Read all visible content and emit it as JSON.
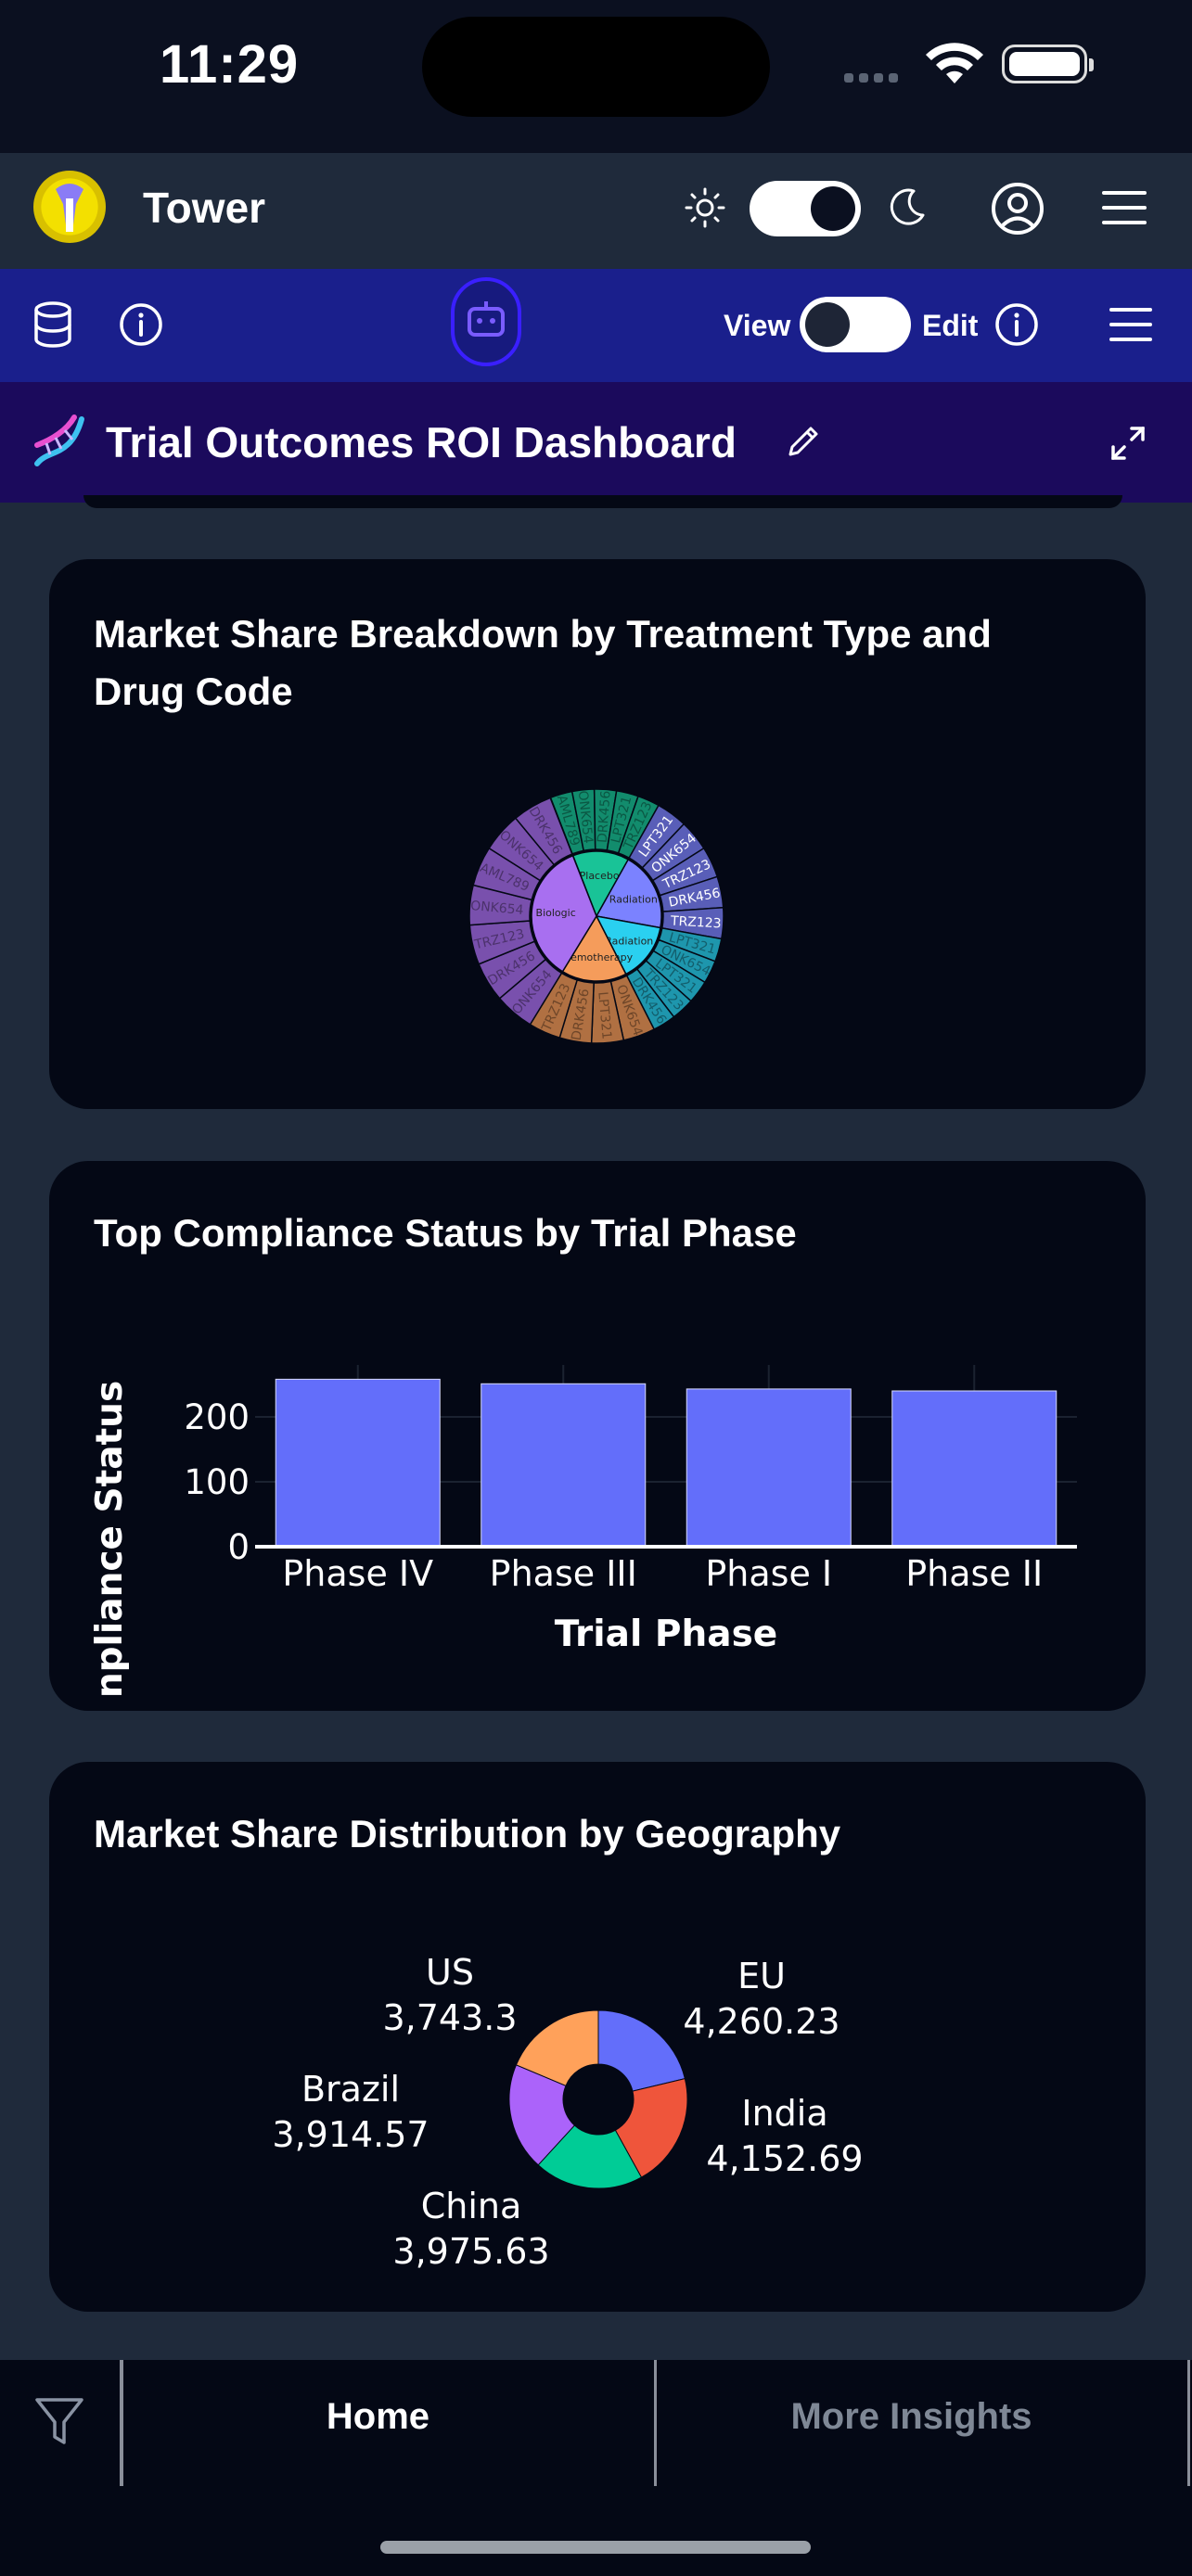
{
  "status_bar": {
    "time": "11:29"
  },
  "header": {
    "app_name": "Tower"
  },
  "toolbar": {
    "view_label": "View",
    "edit_label": "Edit"
  },
  "dashboard": {
    "title": "Trial Outcomes ROI Dashboard"
  },
  "charts": {
    "sunburst_title": "Market Share Breakdown by Treatment Type and Drug Code",
    "bar_title": "Top Compliance Status by Trial Phase",
    "donut_title": "Market Share Distribution by Geography"
  },
  "chart_data": [
    {
      "type": "sunburst",
      "title": "Market Share Breakdown by Treatment Type and Drug Code",
      "inner": [
        {
          "label": "Placebo",
          "color": "#19c397"
        },
        {
          "label": "Radiation",
          "color": "#7b82ff"
        },
        {
          "label": "Radiation",
          "color": "#2ad0f0"
        },
        {
          "label": "Chemotherapy",
          "color": "#f59c5b"
        },
        {
          "label": "Biologic",
          "color": "#a86ff0"
        }
      ],
      "outer_labels_visible": [
        "AML789",
        "ONK654",
        "DRK456",
        "LPT321",
        "TRZ123",
        "LPT321",
        "ONK654",
        "TRZ123",
        "DRK456",
        "TRZ123",
        "LPT321",
        "ONK654",
        "LPT321",
        "TRZ123",
        "DRK456",
        "ONK654",
        "LPT321",
        "DRK456",
        "TRZ123",
        "ONK654",
        "DRK456",
        "TRZ123",
        "ONK654"
      ]
    },
    {
      "type": "bar",
      "title": "Top Compliance Status by Trial Phase",
      "xlabel": "Trial Phase",
      "ylabel": "Compliance Status",
      "ylabel_visible": "npliance Status",
      "categories": [
        "Phase IV",
        "Phase III",
        "Phase I",
        "Phase II"
      ],
      "values": [
        258,
        251,
        243,
        240
      ],
      "yticks": [
        "0",
        "100",
        "200"
      ],
      "ylim": [
        0,
        280
      ],
      "bar_color": "#636efa"
    },
    {
      "type": "pie",
      "hole": true,
      "title": "Market Share Distribution by Geography",
      "labels": [
        "EU",
        "India",
        "China",
        "Brazil",
        "US"
      ],
      "values": [
        4260.23,
        4152.69,
        3975.63,
        3914.57,
        3743.3
      ],
      "value_text": [
        "4,260.23",
        "4,152.69",
        "3,975.63",
        "3,914.57",
        "3,743.3"
      ],
      "colors": [
        "#636efa",
        "#ef553b",
        "#00cc96",
        "#ab63fa",
        "#ffa15a"
      ]
    }
  ],
  "nav": {
    "home": "Home",
    "more": "More Insights"
  }
}
